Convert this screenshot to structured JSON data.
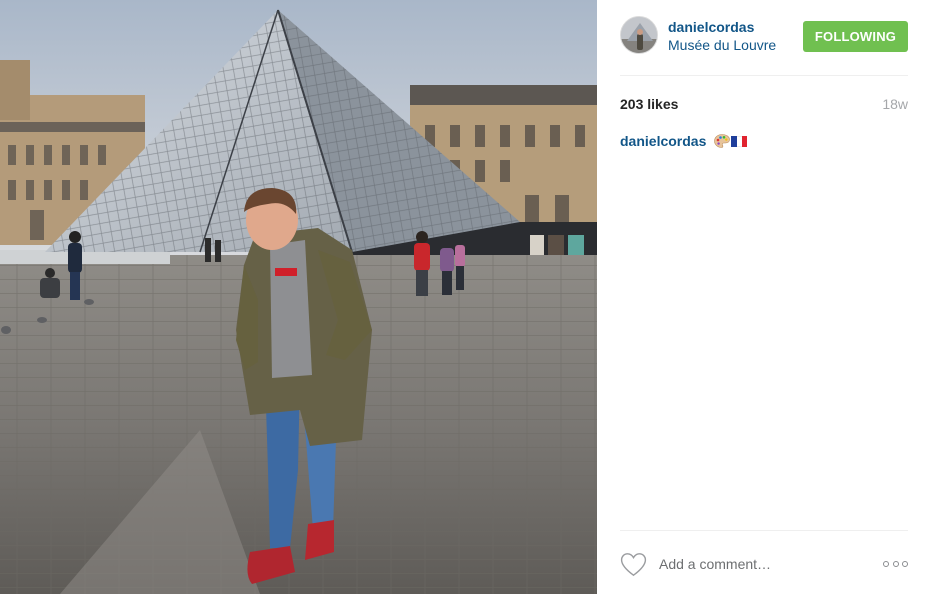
{
  "post": {
    "photo_alt": "Man in olive parka and red sneakers standing in front of the Louvre glass pyramid",
    "author": {
      "username": "danielcordas",
      "location": "Musée du Louvre",
      "follow_label": "FOLLOWING"
    },
    "likes_text": "203 likes",
    "age_text": "18w",
    "caption": {
      "username": "danielcordas",
      "emoji": [
        "artist-palette-icon",
        "flag-france-icon"
      ]
    },
    "comment_placeholder": "Add a comment…"
  },
  "colors": {
    "link": "#125688",
    "follow_button": "#70c050",
    "divider": "#efefef",
    "muted": "#a5a7aa"
  }
}
